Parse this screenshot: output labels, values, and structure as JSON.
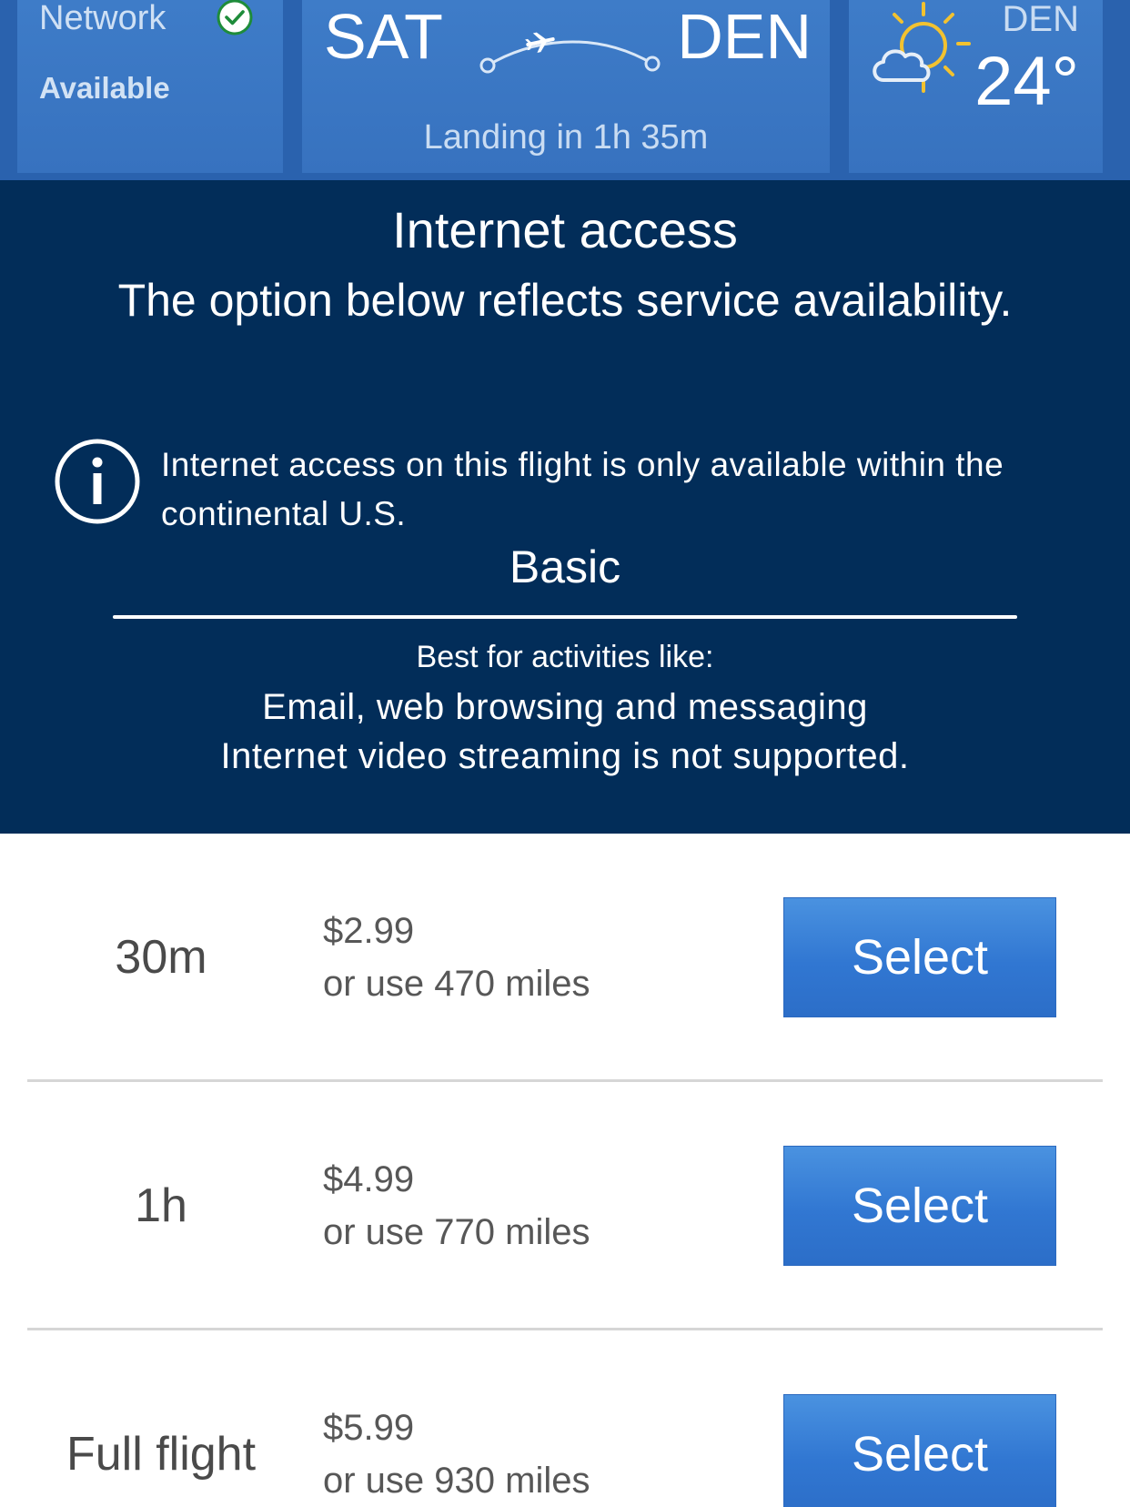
{
  "header": {
    "network": {
      "label": "Network",
      "status": "Available",
      "status_color": "#1e8c3a"
    },
    "flight": {
      "origin": "SAT",
      "destination": "DEN",
      "landing": "Landing in 1h 35m"
    },
    "weather": {
      "city": "DEN",
      "temperature": "24°",
      "icon": "partly-cloudy-icon"
    }
  },
  "panel": {
    "title": "Internet access",
    "subtitle": "The option below reflects service availability.",
    "notice": "Internet access on this flight is only available within the continental U.S.",
    "plan_name": "Basic",
    "best_for": "Best for activities like:",
    "activities": [
      "Email, web browsing and messaging",
      "Internet video streaming is not supported."
    ]
  },
  "options": [
    {
      "duration": "30m",
      "price": "$2.99",
      "miles": "or use 470 miles",
      "button": "Select"
    },
    {
      "duration": "1h",
      "price": "$4.99",
      "miles": "or use 770 miles",
      "button": "Select"
    },
    {
      "duration": "Full flight",
      "price": "$5.99",
      "miles": "or use 930 miles",
      "button": "Select"
    }
  ],
  "colors": {
    "header_blue": "#3a76c4",
    "panel_navy": "#022d59",
    "button_blue": "#3177d2"
  }
}
